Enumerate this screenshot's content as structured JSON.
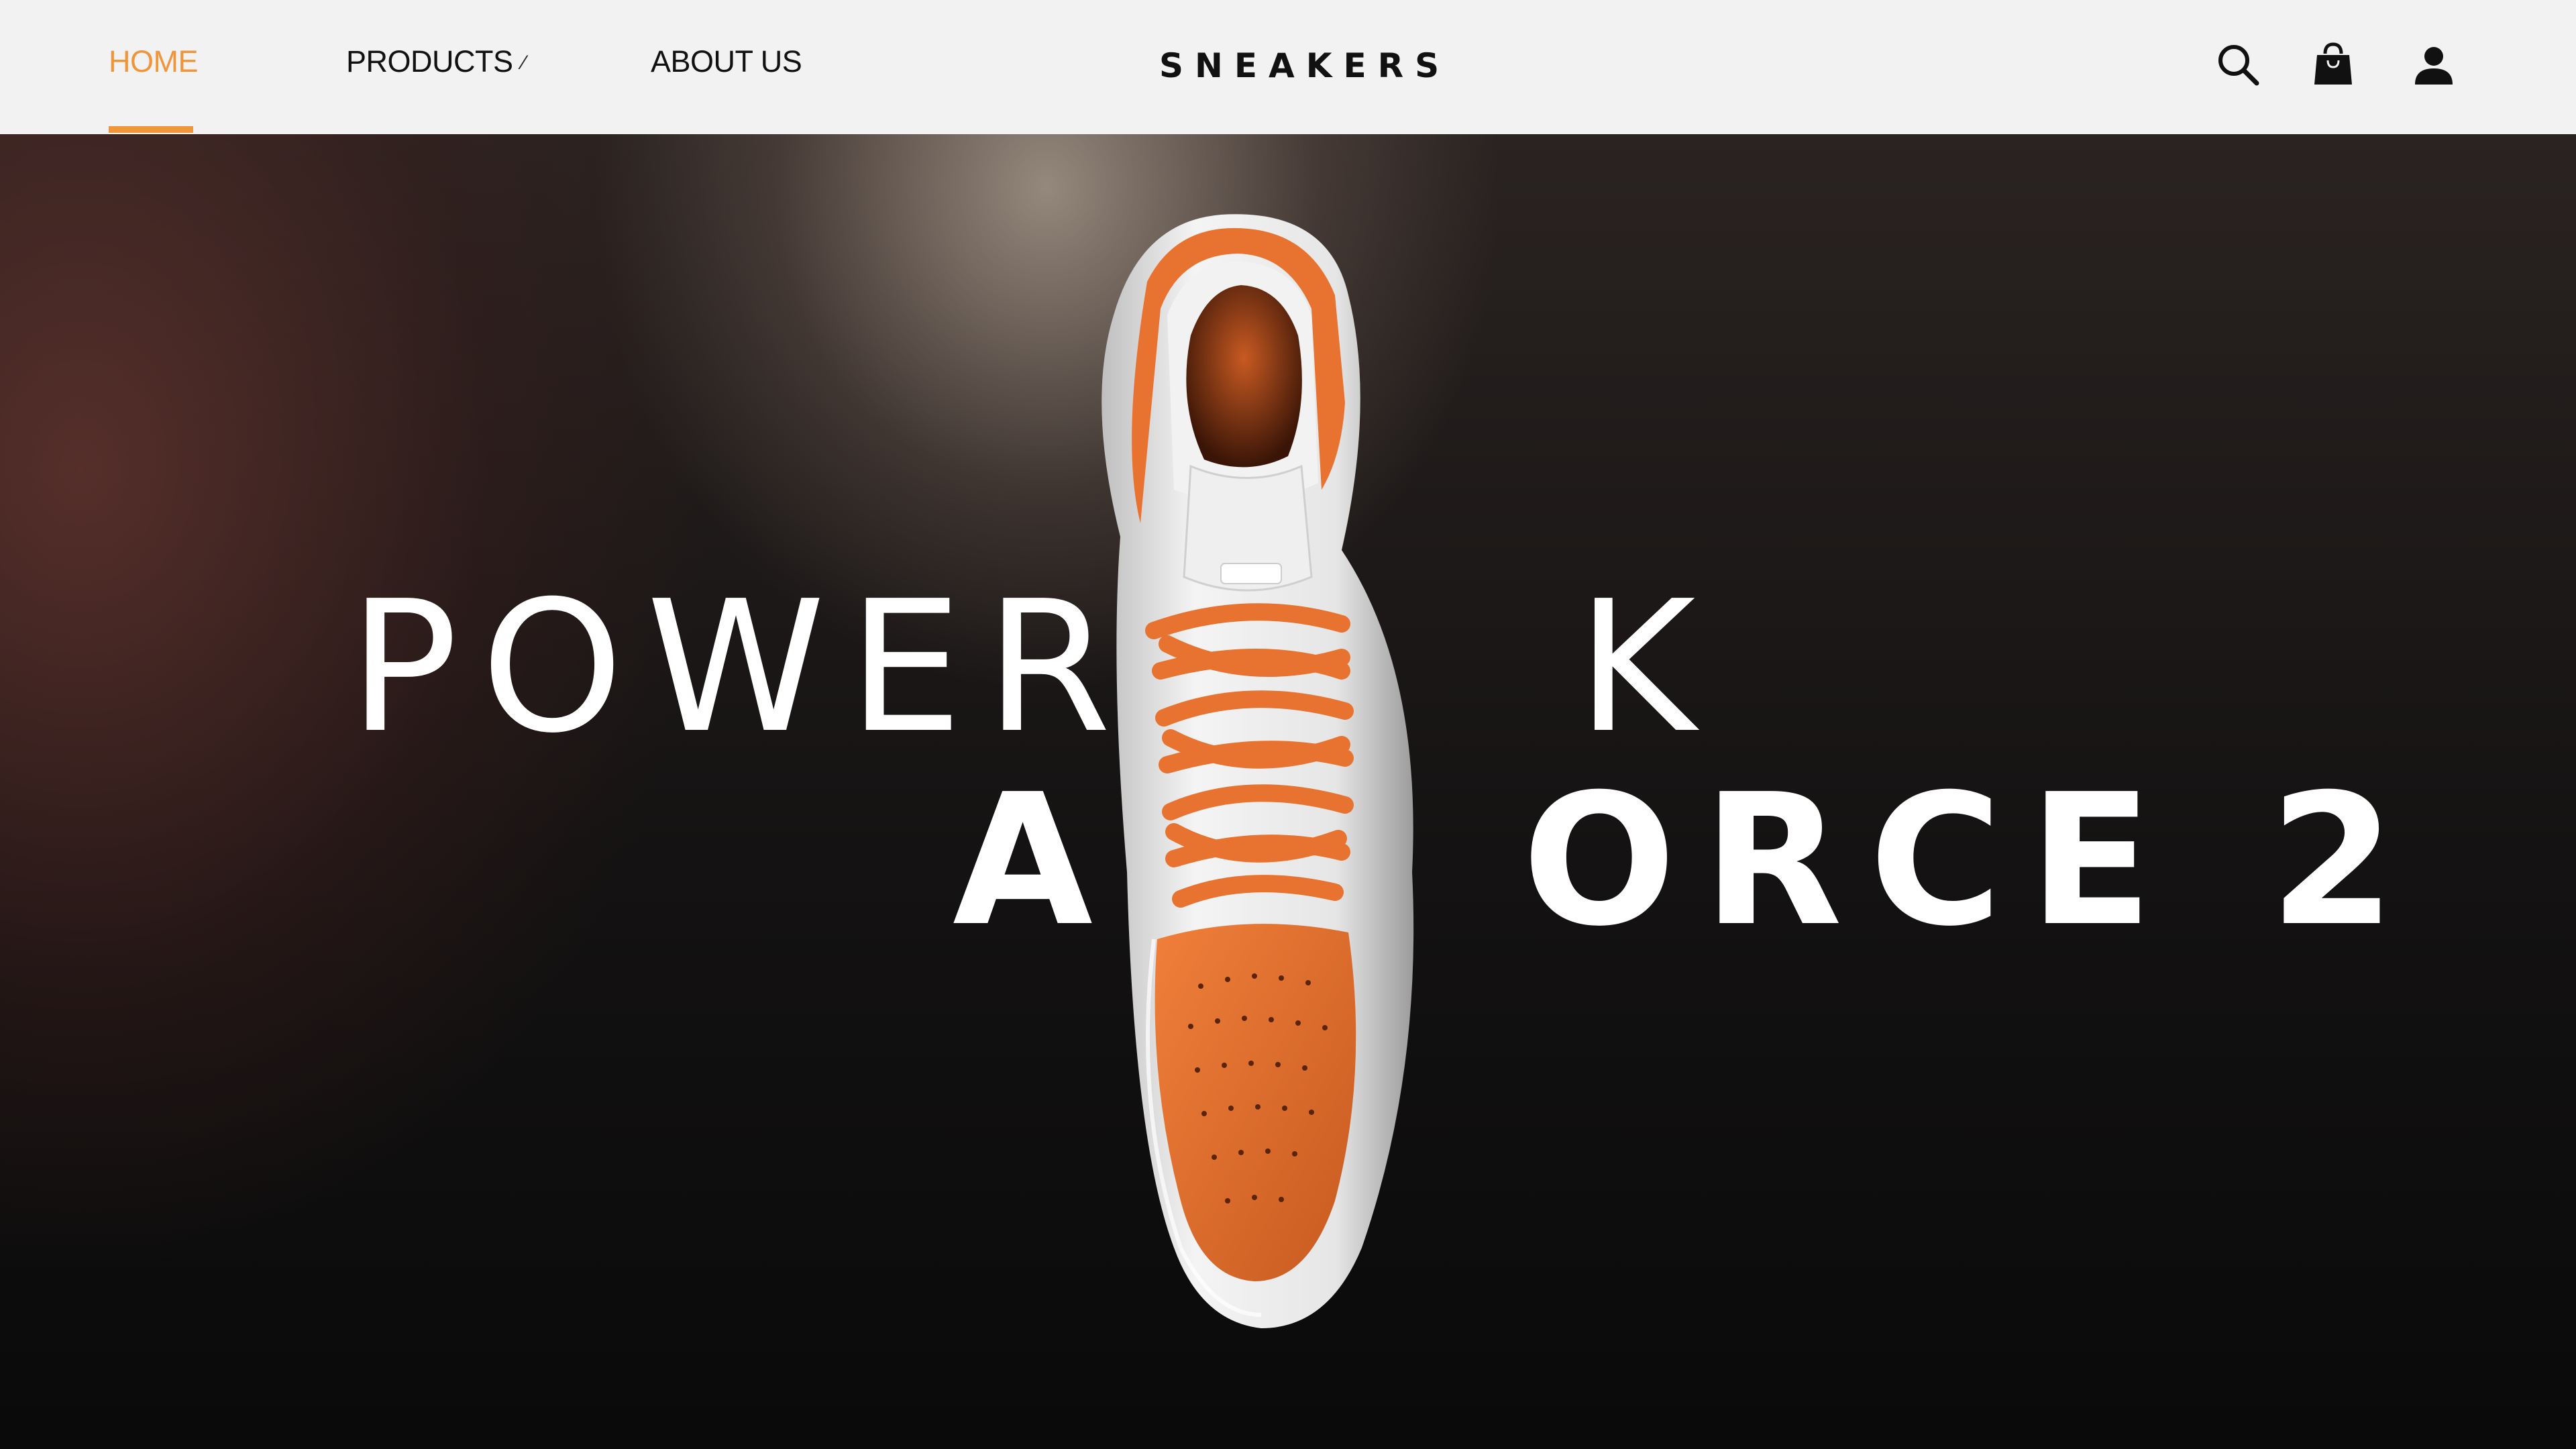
{
  "nav": {
    "items": [
      {
        "label": "HOME",
        "active": true
      },
      {
        "label": "PRODUCTS",
        "has_dropdown": true
      },
      {
        "label": "ABOUT US"
      }
    ],
    "brand": "SNEAKERS",
    "icons": [
      "search-icon",
      "shopping-bag-icon",
      "user-icon"
    ]
  },
  "hero": {
    "line1": "POWER",
    "line1_partial": "K",
    "line2_start": "A",
    "line2_end": "ORCE 2",
    "image": "orange-white-high-top-sneaker"
  },
  "colors": {
    "accent": "#f0953a",
    "nav_bg": "#f2f2f2",
    "shoe_orange": "#e8722f",
    "text_dark": "#111111"
  }
}
